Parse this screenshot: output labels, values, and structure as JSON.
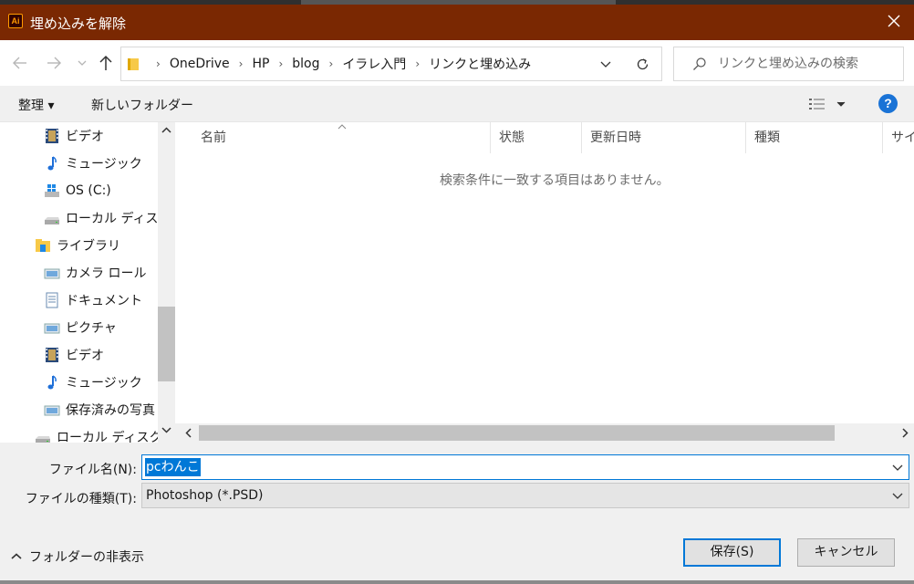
{
  "window": {
    "title": "埋め込みを解除",
    "app_icon_text": "Ai",
    "title_bar_color": "#7a2802",
    "accent_color": "#0078d7"
  },
  "address": {
    "crumbs": [
      "OneDrive",
      "HP",
      "blog",
      "イラレ入門",
      "リンクと埋め込み"
    ],
    "search_placeholder": "リンクと埋め込みの検索"
  },
  "toolbar": {
    "organize_label": "整理 ▾",
    "new_folder_label": "新しいフォルダー"
  },
  "nav": {
    "items": [
      {
        "label": "ビデオ",
        "icon": "video-icon"
      },
      {
        "label": "ミュージック",
        "icon": "music-icon"
      },
      {
        "label": "OS (C:)",
        "icon": "os-drive-icon"
      },
      {
        "label": "ローカル ディスク (",
        "icon": "disk-icon"
      },
      {
        "label": "ライブラリ",
        "icon": "library-icon"
      },
      {
        "label": "カメラ ロール",
        "icon": "camera-roll-icon"
      },
      {
        "label": "ドキュメント",
        "icon": "documents-icon"
      },
      {
        "label": "ピクチャ",
        "icon": "pictures-icon"
      },
      {
        "label": "ビデオ",
        "icon": "video-icon"
      },
      {
        "label": "ミュージック",
        "icon": "music-icon"
      },
      {
        "label": "保存済みの写真",
        "icon": "saved-pictures-icon"
      },
      {
        "label": "ローカル ディスク (D",
        "icon": "disk-icon"
      }
    ]
  },
  "list": {
    "columns": [
      "名前",
      "状態",
      "更新日時",
      "種類",
      "サイズ"
    ],
    "empty_message": "検索条件に一致する項目はありません。"
  },
  "form": {
    "filename_label": "ファイル名(N):",
    "filename_value": "pcわんこ",
    "filetype_label": "ファイルの種類(T):",
    "filetype_value": "Photoshop (*.PSD)",
    "hide_folders_label": "フォルダーの非表示",
    "save_label": "保存(S)",
    "cancel_label": "キャンセル"
  }
}
